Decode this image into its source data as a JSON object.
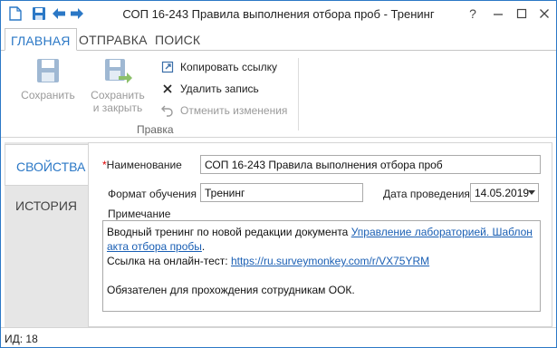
{
  "window": {
    "title": "СОП 16-243 Правила выполнения отбора проб - Тренинг",
    "help_icon": "?",
    "accent": "#2b78c6"
  },
  "ribbon": {
    "tabs": [
      {
        "label": "ГЛАВНАЯ",
        "active": true
      },
      {
        "label": "ОТПРАВКА",
        "active": false
      },
      {
        "label": "ПОИСК",
        "active": false
      }
    ],
    "save_label": "Сохранить",
    "save_close_line1": "Сохранить",
    "save_close_line2": "и закрыть",
    "copy_link_label": "Копировать ссылку",
    "delete_label": "Удалить запись",
    "undo_label": "Отменить изменения",
    "group_label": "Правка"
  },
  "side_tabs": [
    {
      "label": "СВОЙСТВА",
      "active": true
    },
    {
      "label": "ИСТОРИЯ",
      "active": false
    }
  ],
  "form": {
    "required_mark": "*",
    "name_label": "Наименование",
    "name_value": "СОП 16-243 Правила выполнения отбора проб",
    "format_label": "Формат обучения",
    "format_value": "Тренинг",
    "date_label": "Дата проведения",
    "date_value": "14.05.2019",
    "notes_label": "Примечание",
    "notes": {
      "line1_text": "Вводный тренинг по новой редакции документа ",
      "line1_link": "Управление лабораторией. Шаблон акта отбора пробы",
      "line1_end": ".",
      "line2_text": "Ссылка на онлайн-тест: ",
      "line2_link": "https://ru.surveymonkey.com/r/VX75YRM",
      "line4_text": "Обязателен для прохождения сотрудникам ООК."
    }
  },
  "status": {
    "id_text": "ИД: 18"
  }
}
